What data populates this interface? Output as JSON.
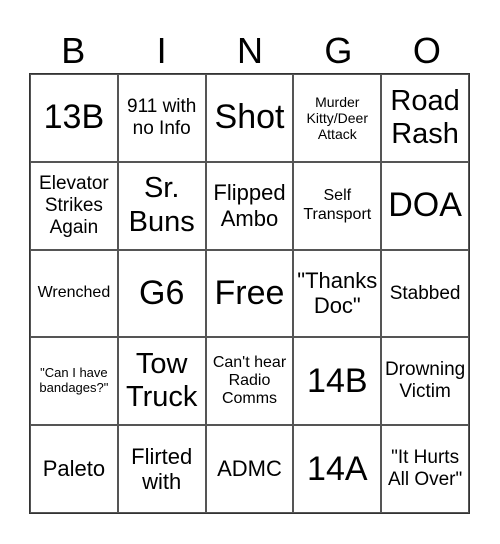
{
  "header": [
    "B",
    "I",
    "N",
    "G",
    "O"
  ],
  "cells": [
    "13B",
    "911 with no Info",
    "Shot",
    "Murder Kitty/Deer Attack",
    "Road Rash",
    "Elevator Strikes Again",
    "Sr. Buns",
    "Flipped Ambo",
    "Self Transport",
    "DOA",
    "Wrenched",
    "G6",
    "Free",
    "\"Thanks Doc\"",
    "Stabbed",
    "\"Can I have bandages?\"",
    "Tow Truck",
    "Can't hear Radio Comms",
    "14B",
    "Drowning Victim",
    "Paleto",
    "Flirted with",
    "ADMC",
    "14A",
    "\"It Hurts All Over\""
  ]
}
